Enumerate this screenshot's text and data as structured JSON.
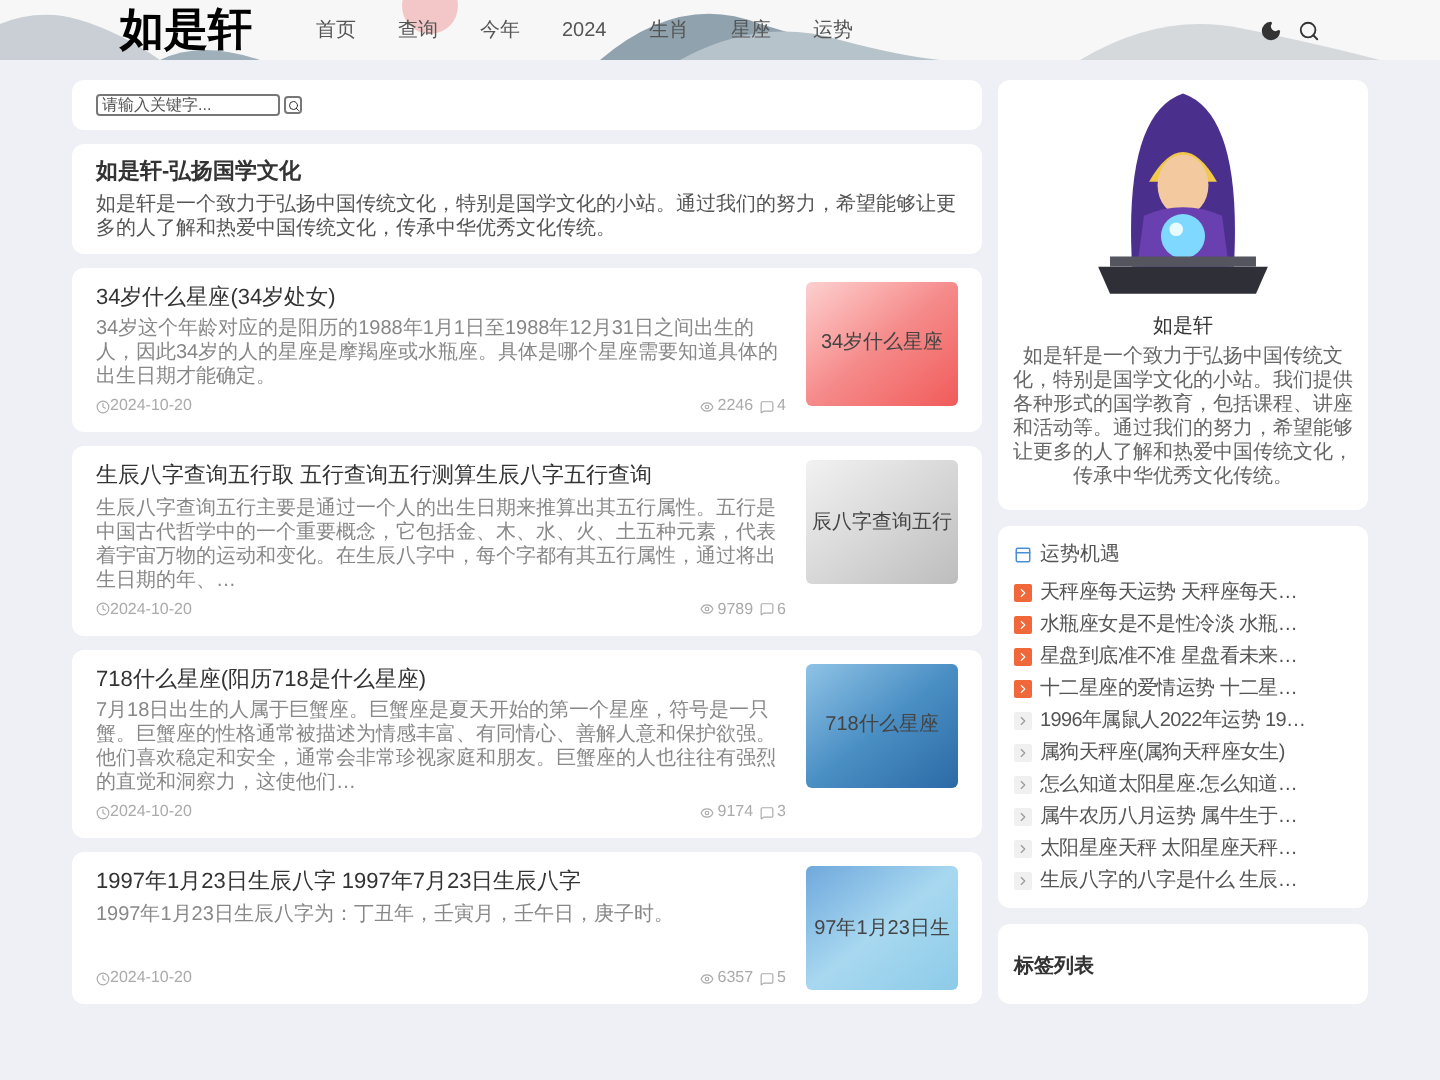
{
  "header": {
    "logo": "如是轩",
    "nav": [
      "首页",
      "查询",
      "今年",
      "2024",
      "生肖",
      "星座",
      "运势"
    ]
  },
  "search": {
    "placeholder": "请输入关键字..."
  },
  "intro": {
    "title": "如是轩-弘扬国学文化",
    "text": "如是轩是一个致力于弘扬中国传统文化，特别是国学文化的小站。通过我们的努力，希望能够让更多的人了解和热爱中国传统文化，传承中华优秀文化传统。"
  },
  "articles": [
    {
      "title": "34岁什么星座(34岁处女)",
      "excerpt": "34岁这个年龄对应的是阳历的1988年1月1日至1988年12月31日之间出生的人，因此34岁的人的星座是摩羯座或水瓶座。具体是哪个星座需要知道具体的出生日期才能确定。",
      "date": "2024-10-20",
      "views": "2246",
      "comments": "4",
      "thumb": {
        "kind": "rose",
        "label": "34岁什么星座"
      }
    },
    {
      "title": "生辰八字查询五行取 五行查询五行测算生辰八字五行查询",
      "excerpt": "生辰八字查询五行主要是通过一个人的出生日期来推算出其五行属性。五行是中国古代哲学中的一个重要概念，它包括金、木、水、火、土五种元素，代表着宇宙万物的运动和变化。在生辰八字中，每个字都有其五行属性，通过将出生日期的年、…",
      "date": "2024-10-20",
      "views": "9789",
      "comments": "6",
      "thumb": {
        "kind": "silver",
        "label": "辰八字查询五行"
      }
    },
    {
      "title": "718什么星座(阳历718是什么星座)",
      "excerpt": "7月18日出生的人属于巨蟹座。巨蟹座是夏天开始的第一个星座，符号是一只蟹。巨蟹座的性格通常被描述为情感丰富、有同情心、善解人意和保护欲强。他们喜欢稳定和安全，通常会非常珍视家庭和朋友。巨蟹座的人也往往有强烈的直觉和洞察力，这使他们…",
      "date": "2024-10-20",
      "views": "9174",
      "comments": "3",
      "thumb": {
        "kind": "ocean",
        "label": "718什么星座"
      }
    },
    {
      "title": "1997年1月23日生辰八字 1997年7月23日生辰八字",
      "excerpt": "1997年1月23日生辰八字为：丁丑年，壬寅月，壬午日，庚子时。",
      "date": "2024-10-20",
      "views": "6357",
      "comments": "5",
      "thumb": {
        "kind": "sky",
        "label": "97年1月23日生"
      }
    }
  ],
  "profile": {
    "name": "如是轩",
    "text": "如是轩是一个致力于弘扬中国传统文化，特别是国学文化的小站。我们提供各种形式的国学教育，包括课程、讲座和活动等。通过我们的努力，希望能够让更多的人了解和热爱中国传统文化，传承中华优秀文化传统。"
  },
  "fortune": {
    "title": "运势机遇",
    "items": [
      {
        "text": "天秤座每天运势 天秤座每天…",
        "hot": true
      },
      {
        "text": "水瓶座女是不是性冷淡 水瓶…",
        "hot": true
      },
      {
        "text": "星盘到底准不准 星盘看未来…",
        "hot": true
      },
      {
        "text": "十二星座的爱情运势 十二星…",
        "hot": true
      },
      {
        "text": "1996年属鼠人2022年运势 19…",
        "hot": false
      },
      {
        "text": "属狗天秤座(属狗天秤座女生)",
        "hot": false
      },
      {
        "text": "怎么知道太阳星座.怎么知道…",
        "hot": false
      },
      {
        "text": "属牛农历八月运势 属牛生于…",
        "hot": false
      },
      {
        "text": "太阳星座天秤 太阳星座天秤…",
        "hot": false
      },
      {
        "text": "生辰八字的八字是什么 生辰…",
        "hot": false
      }
    ]
  },
  "tags": {
    "title": "标签列表"
  }
}
